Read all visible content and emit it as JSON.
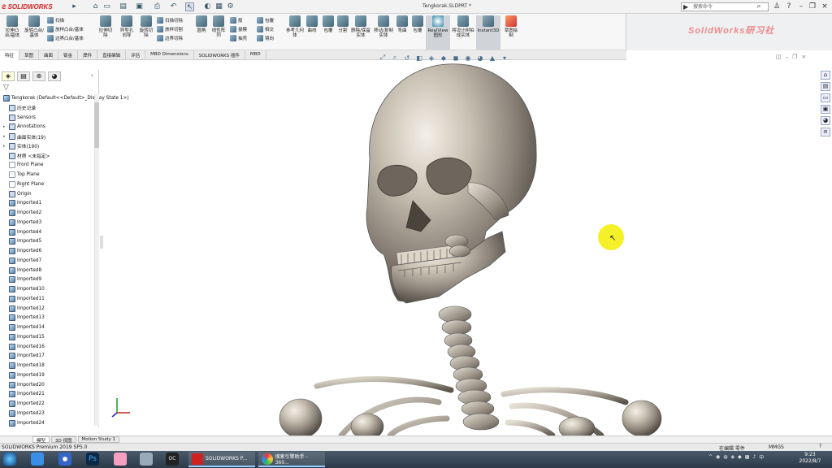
{
  "app": {
    "logo": "SOLIDWORKS",
    "document_title": "Tengkorak.SLDPRT *",
    "search_placeholder": "搜索命令"
  },
  "ribbon": {
    "buttons": [
      {
        "label": "拉伸凸台/基体",
        "icon": "extrude-boss-icon"
      },
      {
        "label": "旋转凸台/基体",
        "icon": "revolve-boss-icon"
      },
      {
        "label": "拉伸切除",
        "icon": "extrude-cut-icon"
      },
      {
        "label": "异型孔向导",
        "icon": "hole-wizard-icon"
      },
      {
        "label": "旋转切除",
        "icon": "revolve-cut-icon"
      },
      {
        "label": "圆角",
        "icon": "fillet-icon"
      },
      {
        "label": "线性阵列",
        "icon": "linear-pattern-icon"
      },
      {
        "label": "参考几何体",
        "icon": "reference-geometry-icon"
      },
      {
        "label": "曲线",
        "icon": "curves-icon"
      },
      {
        "label": "包覆",
        "icon": "wrap-icon"
      },
      {
        "label": "分割",
        "icon": "split-icon"
      },
      {
        "label": "删除/保留实体",
        "icon": "delete-body-icon"
      },
      {
        "label": "移动/复制实体",
        "icon": "move-copy-icon"
      },
      {
        "label": "弯曲",
        "icon": "flex-icon"
      },
      {
        "label": "包覆",
        "icon": "wrap-icon"
      },
      {
        "label": "RealView图形",
        "icon": "realview-icon"
      },
      {
        "label": "将设计树拍成实体",
        "icon": "tree-icon"
      },
      {
        "label": "Instant3D",
        "icon": "instant3d-icon"
      },
      {
        "label": "草图绘制",
        "icon": "sketch-icon"
      }
    ],
    "small": [
      {
        "label": "扫描",
        "icon": "sweep-icon"
      },
      {
        "label": "放样凸台/基体",
        "icon": "loft-icon"
      },
      {
        "label": "边界凸台/基体",
        "icon": "boundary-icon"
      },
      {
        "label": "扫描切除",
        "icon": "swept-cut-icon"
      },
      {
        "label": "放样切割",
        "icon": "lofted-cut-icon"
      },
      {
        "label": "边界切除",
        "icon": "boundary-cut-icon"
      },
      {
        "label": "筋",
        "icon": "rib-icon"
      },
      {
        "label": "拔模",
        "icon": "draft-icon"
      },
      {
        "label": "抽壳",
        "icon": "shell-icon"
      },
      {
        "label": "包覆",
        "icon": "wrap-icon"
      },
      {
        "label": "相交",
        "icon": "intersect-icon"
      },
      {
        "label": "镜向",
        "icon": "mirror-icon"
      }
    ],
    "watermark": "SolidWorks研习社"
  },
  "tabs": [
    "特征",
    "草图",
    "曲面",
    "钣金",
    "焊件",
    "直接编辑",
    "评估",
    "MBD Dimensions",
    "SOLIDWORKS 插件",
    "MBD"
  ],
  "active_tab": "特征",
  "tree": {
    "root": "Tengkorak  (Default<<Default>_Display State 1>)",
    "items": [
      {
        "label": "历史记录",
        "icon": "history-icon",
        "expander": ""
      },
      {
        "label": "Sensors",
        "icon": "sensor-icon",
        "expander": ""
      },
      {
        "label": "Annotations",
        "icon": "annotations-icon",
        "expander": "▸"
      },
      {
        "label": "曲面实体(19)",
        "icon": "surface-bodies-icon",
        "expander": "▸"
      },
      {
        "label": "实体(190)",
        "icon": "solid-bodies-icon",
        "expander": "▸"
      },
      {
        "label": "材质 <未指定>",
        "icon": "material-icon",
        "expander": ""
      },
      {
        "label": "Front Plane",
        "icon": "plane-icon",
        "expander": ""
      },
      {
        "label": "Top Plane",
        "icon": "plane-icon",
        "expander": ""
      },
      {
        "label": "Right Plane",
        "icon": "plane-icon",
        "expander": ""
      },
      {
        "label": "Origin",
        "icon": "origin-icon",
        "expander": ""
      },
      {
        "label": "Imported1",
        "icon": "body-icon",
        "expander": ""
      },
      {
        "label": "Imported2",
        "icon": "body-icon",
        "expander": ""
      },
      {
        "label": "Imported3",
        "icon": "body-icon",
        "expander": ""
      },
      {
        "label": "Imported4",
        "icon": "body-icon",
        "expander": ""
      },
      {
        "label": "Imported5",
        "icon": "body-icon",
        "expander": ""
      },
      {
        "label": "Imported6",
        "icon": "body-icon",
        "expander": ""
      },
      {
        "label": "Imported7",
        "icon": "body-icon",
        "expander": ""
      },
      {
        "label": "Imported8",
        "icon": "body-icon",
        "expander": ""
      },
      {
        "label": "Imported9",
        "icon": "body-icon",
        "expander": ""
      },
      {
        "label": "Imported10",
        "icon": "body-icon",
        "expander": ""
      },
      {
        "label": "Imported11",
        "icon": "body-icon",
        "expander": ""
      },
      {
        "label": "Imported12",
        "icon": "body-icon",
        "expander": ""
      },
      {
        "label": "Imported13",
        "icon": "body-icon",
        "expander": ""
      },
      {
        "label": "Imported14",
        "icon": "body-icon",
        "expander": ""
      },
      {
        "label": "Imported15",
        "icon": "body-icon",
        "expander": ""
      },
      {
        "label": "Imported16",
        "icon": "body-icon",
        "expander": ""
      },
      {
        "label": "Imported17",
        "icon": "body-icon",
        "expander": ""
      },
      {
        "label": "Imported18",
        "icon": "body-icon",
        "expander": ""
      },
      {
        "label": "Imported19",
        "icon": "body-icon",
        "expander": ""
      },
      {
        "label": "Imported20",
        "icon": "body-icon",
        "expander": ""
      },
      {
        "label": "Imported21",
        "icon": "body-icon",
        "expander": ""
      },
      {
        "label": "Imported22",
        "icon": "body-icon",
        "expander": ""
      },
      {
        "label": "Imported23",
        "icon": "body-icon",
        "expander": ""
      },
      {
        "label": "Imported24",
        "icon": "body-icon",
        "expander": ""
      }
    ]
  },
  "bottom_tabs": [
    "模型",
    "3D 视图",
    "Motion Study 1"
  ],
  "status": {
    "left": "SOLIDWORKS Premium 2019 SP5.0",
    "editing": "在编辑 零件",
    "units": "MMGS"
  },
  "taskbar": {
    "windows": [
      {
        "label": "SOLIDWORKS P..."
      },
      {
        "label": "搜索引擎助手 - 360..."
      }
    ],
    "time": "9:23",
    "date": "2022/8/7"
  },
  "colors": {
    "brand": "#d22",
    "cursor_highlight": "#f4f12a",
    "watermark": "#e88"
  }
}
